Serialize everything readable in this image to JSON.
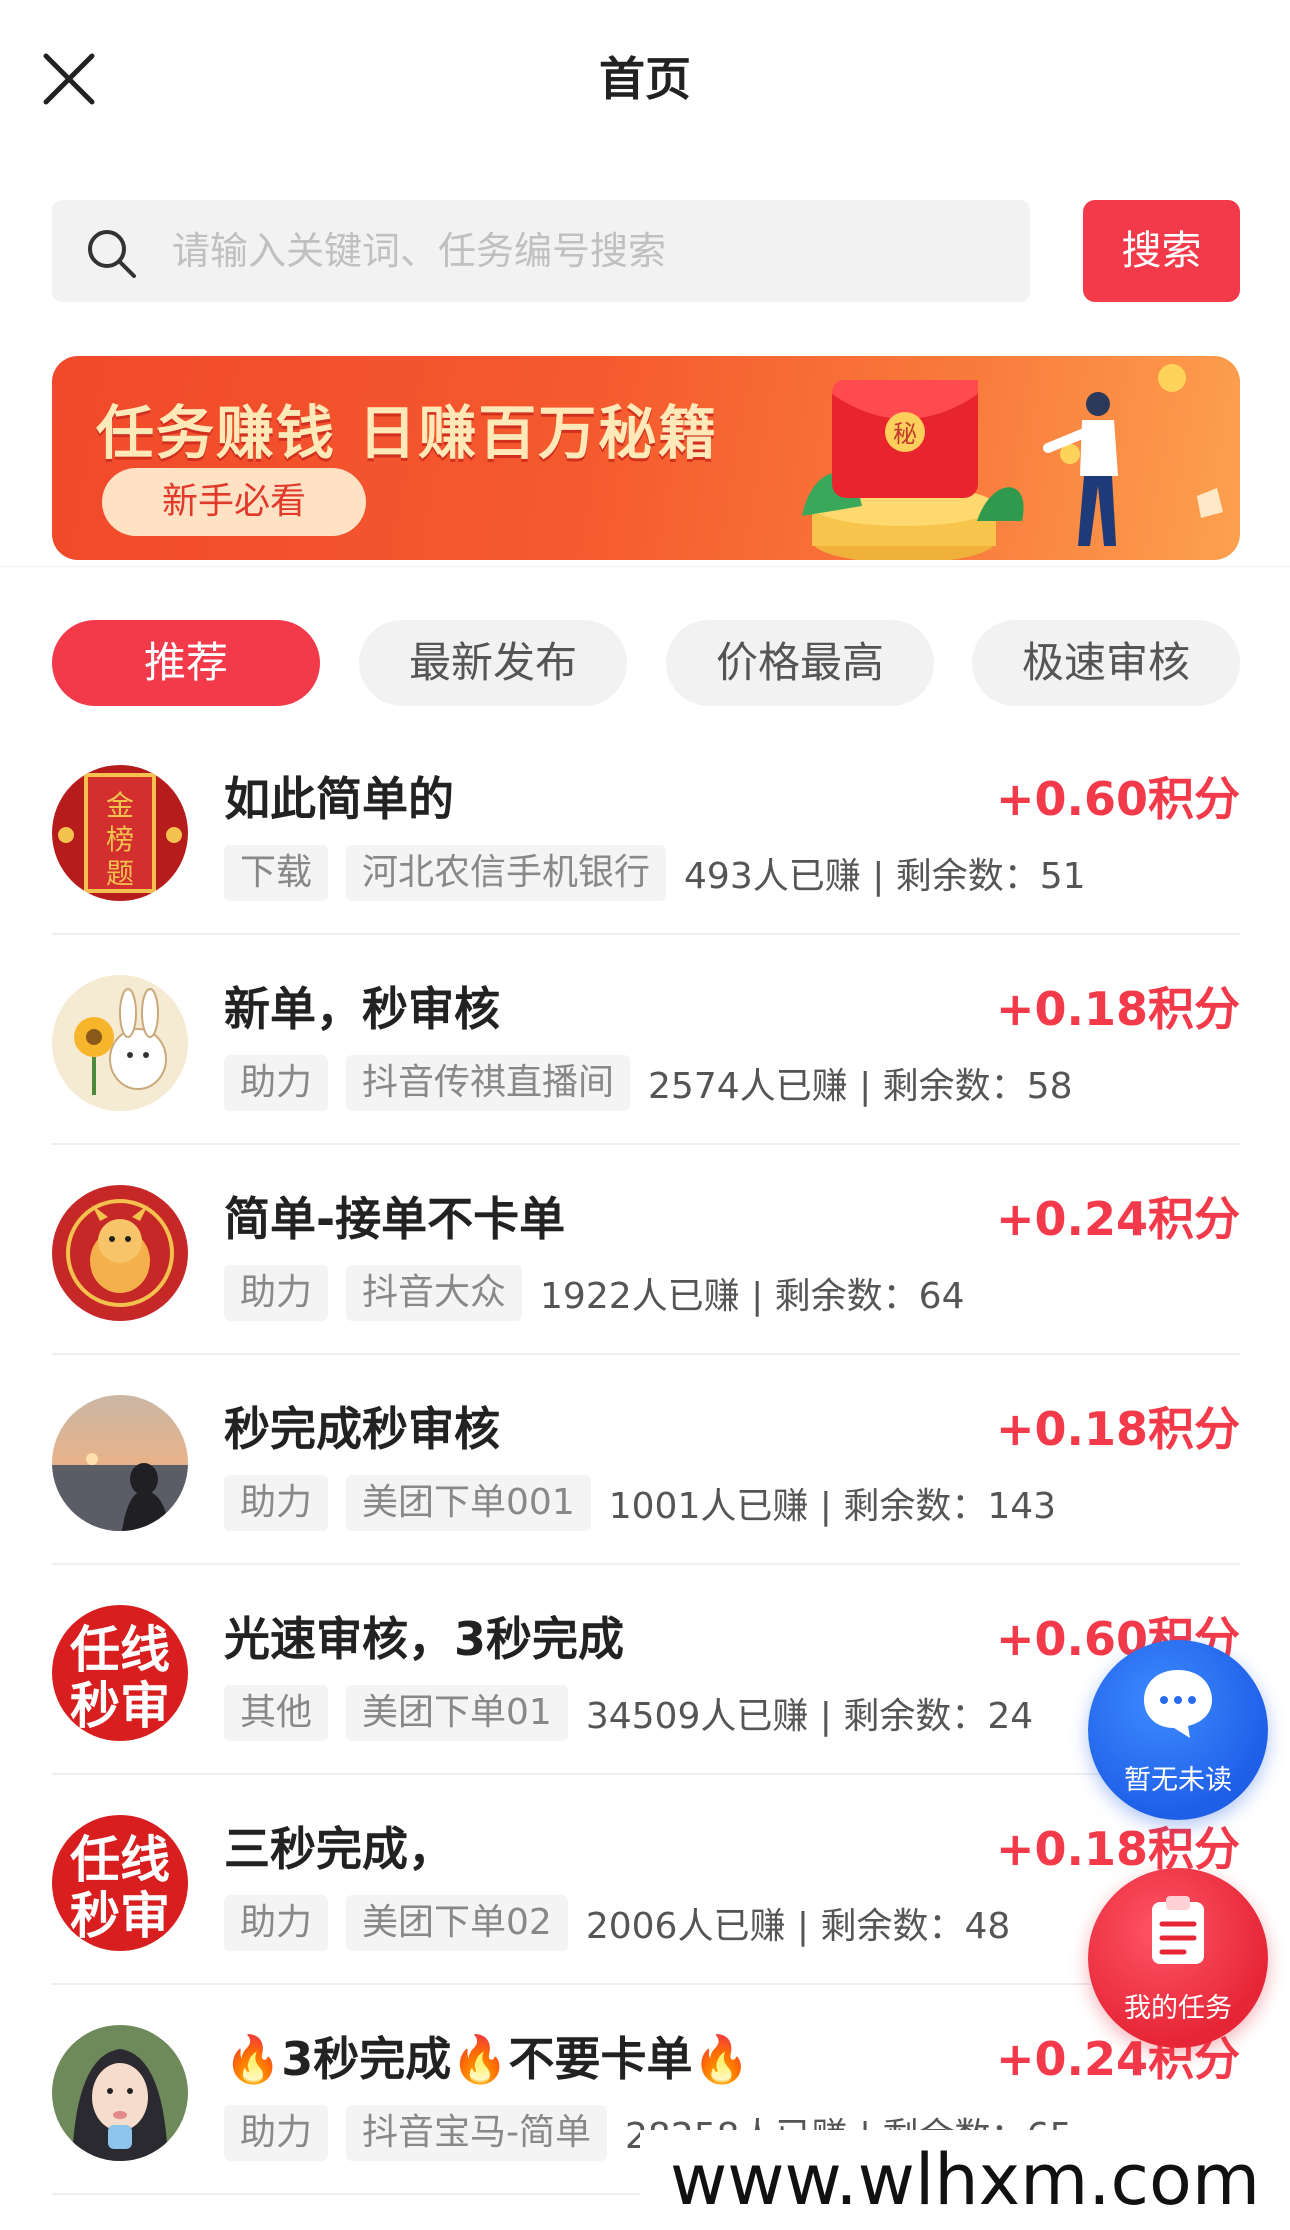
{
  "header": {
    "title": "首页"
  },
  "search": {
    "placeholder": "请输入关键词、任务编号搜索",
    "button_label": "搜索"
  },
  "banner": {
    "title": "任务赚钱  日赚百万秘籍",
    "pill": "新手必看",
    "seal": "秘"
  },
  "tabs": [
    {
      "label": "推荐",
      "active": true
    },
    {
      "label": "最新发布",
      "active": false
    },
    {
      "label": "价格最高",
      "active": false
    },
    {
      "label": "极速审核",
      "active": false
    }
  ],
  "tasks": [
    {
      "title": "如此简单的",
      "reward": "+0.60积分",
      "tags": [
        "下载",
        "河北农信手机银行"
      ],
      "stats": "493人已赚 | 剩余数：51",
      "avatar": "gold-banner"
    },
    {
      "title": "新单，秒审核",
      "reward": "+0.18积分",
      "tags": [
        "助力",
        "抖音传祺直播间"
      ],
      "stats": "2574人已赚 | 剩余数：58",
      "avatar": "bunny-sunflower"
    },
    {
      "title": "简单-接单不卡单",
      "reward": "+0.24积分",
      "tags": [
        "助力",
        "抖音大众"
      ],
      "stats": "1922人已赚 | 剩余数：64",
      "avatar": "red-dragon"
    },
    {
      "title": "秒完成秒审核",
      "reward": "+0.18积分",
      "tags": [
        "助力",
        "美团下单001"
      ],
      "stats": "1001人已赚 | 剩余数：143",
      "avatar": "sunset-beach"
    },
    {
      "title": "光速审核，3秒完成",
      "reward": "+0.60积分",
      "tags": [
        "其他",
        "美团下单01"
      ],
      "stats": "34509人已赚 | 剩余数：24",
      "avatar": "red-text",
      "avatar_text": "任线秒审"
    },
    {
      "title": "三秒完成，",
      "reward": "+0.18积分",
      "tags": [
        "助力",
        "美团下单02"
      ],
      "stats": "2006人已赚 | 剩余数：48",
      "avatar": "red-text",
      "avatar_text": "任线秒审"
    },
    {
      "title": "🔥3秒完成🔥不要卡单🔥",
      "reward": "+0.24积分",
      "tags": [
        "助力",
        "抖音宝马-简单"
      ],
      "stats": "28258人已赚 | 剩余数：65",
      "avatar": "girl-portrait"
    }
  ],
  "fabs": {
    "messages": "暂无未读",
    "my_tasks": "我的任务"
  },
  "watermark": "www.wlhxm.com",
  "colors": {
    "accent": "#f23a4a",
    "blue": "#1f5fe8"
  }
}
